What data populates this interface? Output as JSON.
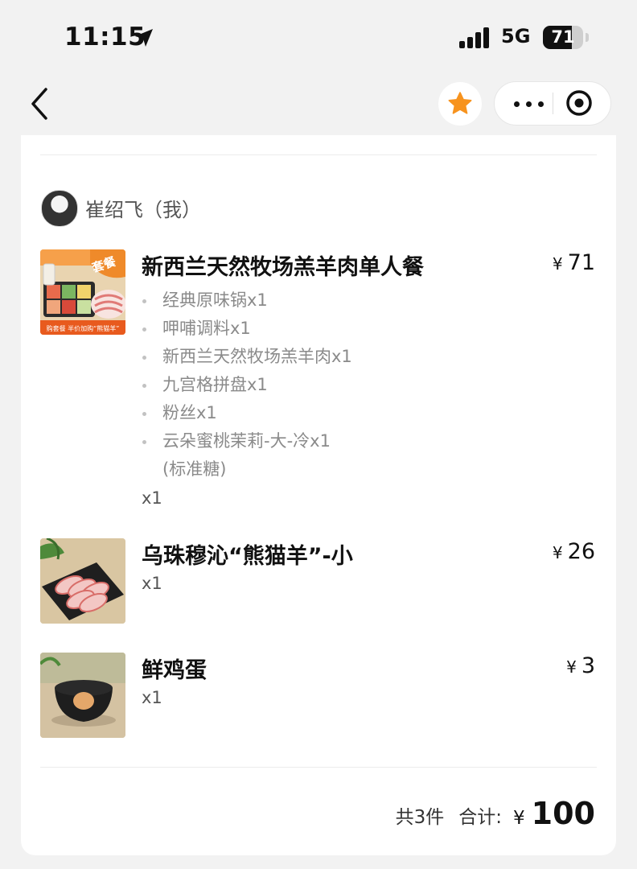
{
  "status_bar": {
    "time": "11:15",
    "network": "5G",
    "battery": "71",
    "battery_level": 0.71
  },
  "nav": {
    "back_icon": "chevron-left-icon",
    "favorite_icon": "star-icon",
    "more_icon": "more-dots-icon",
    "close_icon": "target-icon"
  },
  "colors": {
    "star": "#f7931e",
    "background": "#f2f2f2",
    "card": "#ffffff"
  },
  "user": {
    "name": "崔绍飞（我）"
  },
  "items": [
    {
      "title": "新西兰天然牧场羔羊肉单人餐",
      "price_symbol": "¥",
      "price": "71",
      "qty": "x1",
      "image_badge": "套餐",
      "image_caption": "购套餐 半价加购“熊猫羊”",
      "sub_items": [
        "经典原味锅x1",
        "呷哺调料x1",
        "新西兰天然牧场羔羊肉x1",
        "九宫格拼盘x1",
        "粉丝x1",
        "云朵蜜桃茉莉-大-冷x1"
      ],
      "sub_note": "(标准糖)"
    },
    {
      "title": "乌珠穆沁“熊猫羊”-小",
      "price_symbol": "¥",
      "price": "26",
      "qty": "x1"
    },
    {
      "title": "鲜鸡蛋",
      "price_symbol": "¥",
      "price": "3",
      "qty": "x1"
    }
  ],
  "summary": {
    "count": "共3件",
    "total_label": "合计:",
    "currency": "¥",
    "total": "100"
  }
}
